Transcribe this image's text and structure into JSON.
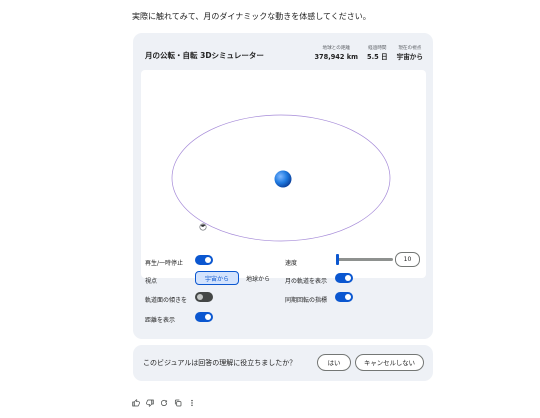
{
  "intro_text": "実際に触れてみて、月のダイナミックな動きを体感してください。",
  "card": {
    "title": "月の公転・自転 3Dシミュレーター",
    "stats": [
      {
        "label": "地球との距離",
        "value": "378,942 km"
      },
      {
        "label": "経過時間",
        "value": "5.5 日"
      },
      {
        "label": "現在の視点",
        "value": "宇宙から"
      }
    ]
  },
  "controls": {
    "play_label": "再生/一時停止",
    "play_on": true,
    "speed_label": "速度",
    "speed_value": "10",
    "speed_fraction": 0.01,
    "viewpoint_label": "視点",
    "view_space": "宇宙から",
    "view_earth": "地球から",
    "orbit_label": "月の軌道を表示",
    "orbit_on": true,
    "tilt_label": "軌道面の傾きを",
    "tilt_on": false,
    "sync_label": "同期回転の指標",
    "sync_on": true,
    "distance_label": "距離を表示",
    "distance_on": true
  },
  "feedback": {
    "question": "このビジュアルは回答の理解に役立ちましたか？",
    "yes": "はい",
    "cancel": "キャンセルしない"
  },
  "colors": {
    "accent": "#0b57d0",
    "orbit": "#a58ad8",
    "earth": "#1f7ae0",
    "card_bg": "#eef1f6"
  },
  "icons": [
    "thumb-up-icon",
    "thumb-down-icon",
    "refresh-icon",
    "copy-icon",
    "more-vert-icon"
  ]
}
